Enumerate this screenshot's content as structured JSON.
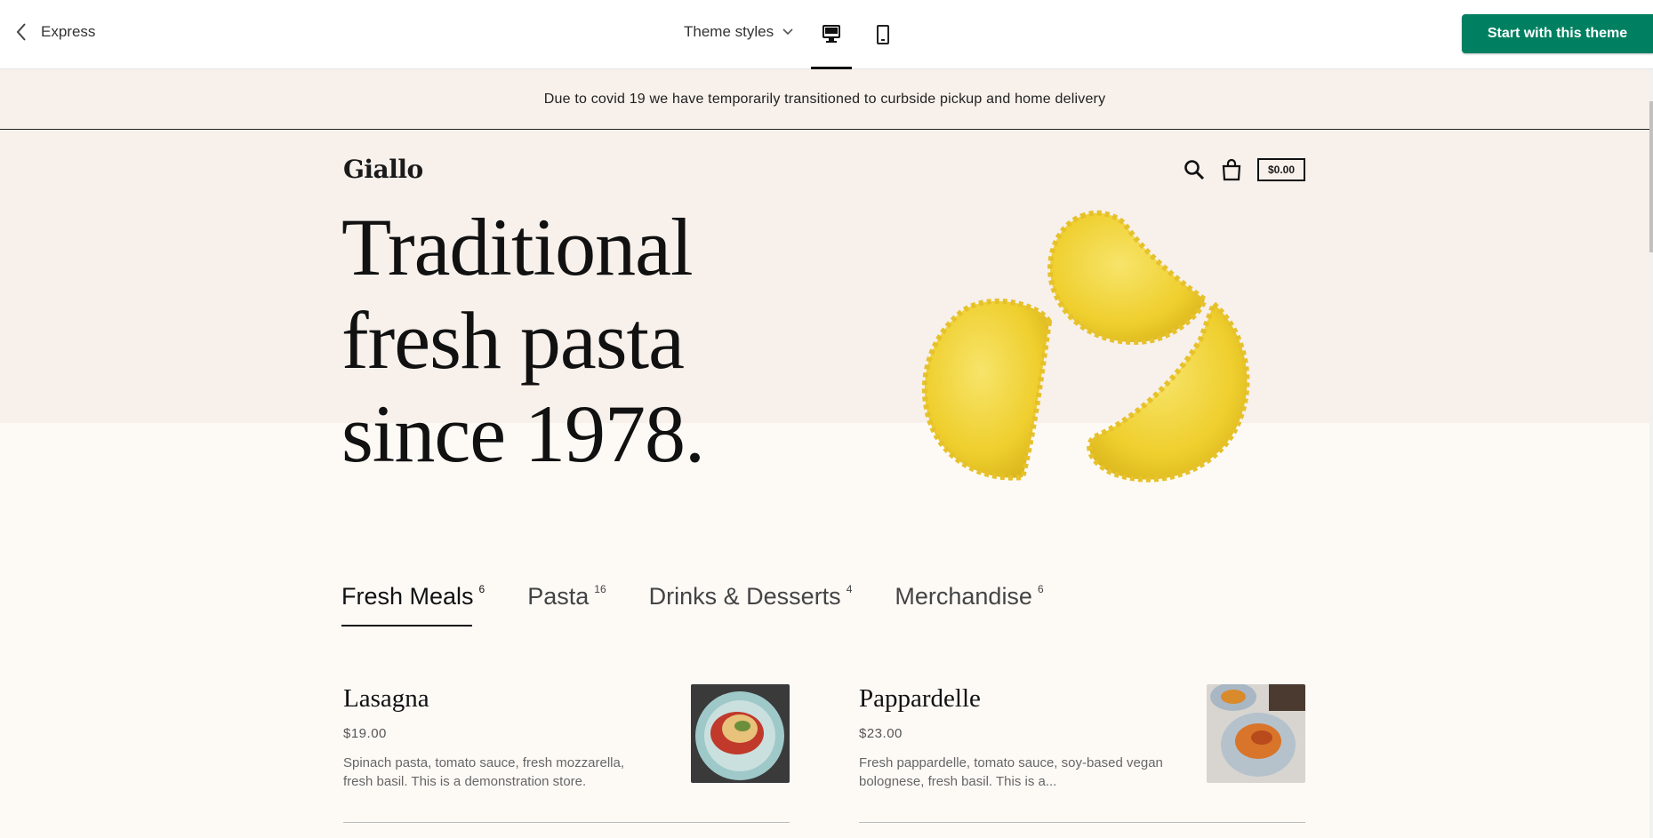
{
  "topbar": {
    "back_label": "Express",
    "styles_label": "Theme styles",
    "start_button": "Start with this theme"
  },
  "store": {
    "announcement": "Due to covid 19 we have temporarily transitioned to curbside pickup and home delivery",
    "logo": "Giallo",
    "cart_total": "$0.00",
    "headline": [
      "Traditional",
      "fresh pasta",
      "since 1978."
    ]
  },
  "tabs": [
    {
      "label": "Fresh Meals",
      "count": "6",
      "active": true
    },
    {
      "label": "Pasta",
      "count": "16"
    },
    {
      "label": "Drinks & Desserts",
      "count": "4"
    },
    {
      "label": "Merchandise",
      "count": "6"
    }
  ],
  "products": [
    {
      "name": "Lasagna",
      "price": "$19.00",
      "desc": "Spinach pasta, tomato sauce, fresh mozzarella, fresh basil. This is a demonstration store."
    },
    {
      "name": "Pappardelle",
      "price": "$23.00",
      "desc": "Fresh pappardelle, tomato sauce, soy-based vegan bolognese, fresh basil.   This is a..."
    }
  ],
  "colors": {
    "accent": "#008060",
    "hero_bg": "#f7f0eb",
    "page_bg": "#fdfaf6",
    "pasta": "#f2d23c"
  }
}
